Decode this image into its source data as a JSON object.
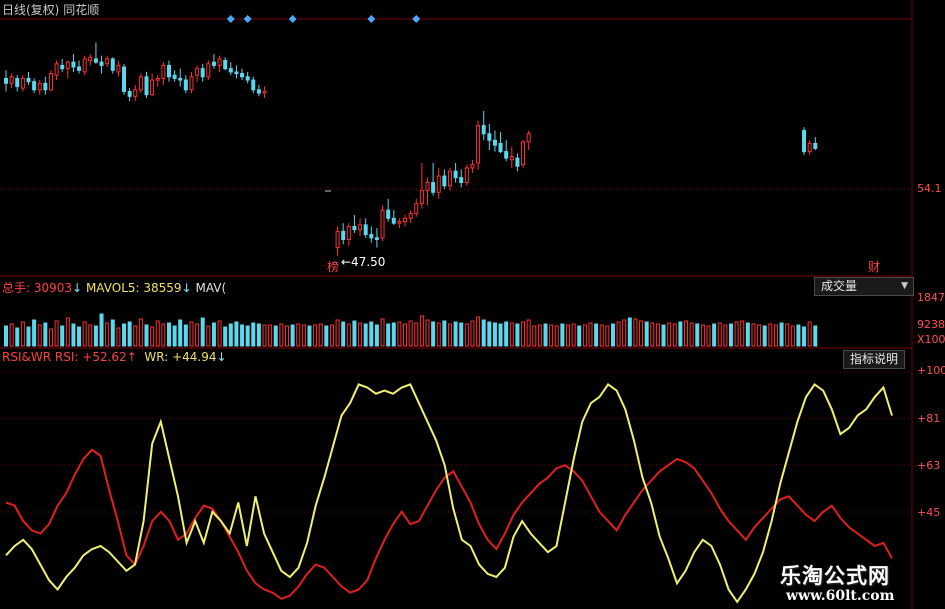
{
  "header": {
    "chart_title": "日线(复权)",
    "software": "同花顺",
    "last_price_label": "54.1",
    "low_marker": "←47.50",
    "low_tag": "榜",
    "right_tag": "财"
  },
  "volume_header": {
    "name": "总手:",
    "value": "30903",
    "value_arrow": "↓",
    "mavol5_label": "MAVOL5:",
    "mavol5_value": "38559",
    "mavol5_arrow": "↓",
    "mavol10_label": "MAV("
  },
  "volume_button": {
    "label": "成交量",
    "arrow": "▼"
  },
  "volume_axis": {
    "top": "1847",
    "mid": "9238",
    "unit": "X100"
  },
  "rsi_header": {
    "name": "RSI&WR",
    "rsi_label": "RSI:",
    "rsi_value": "+52.62",
    "rsi_arrow": "↑",
    "wr_label": "WR:",
    "wr_value": "+44.94",
    "wr_arrow": "↓"
  },
  "indicator_button": {
    "label": "指标说明"
  },
  "rsi_axis": [
    "+100",
    "+81",
    "+63",
    "+45"
  ],
  "watermark": {
    "cn": "乐淘公式网",
    "url": "www.60lt.com"
  },
  "colors": {
    "up": "#ff3030",
    "down": "#5ad8ee",
    "rsi": "#e02020",
    "wr": "#f0f070",
    "grid": "#7a0000",
    "diamond": "#4aa8ff"
  },
  "chart_data": [
    {
      "type": "candlestick",
      "ylim": [
        46.5,
        61.5
      ],
      "candles": [
        [
          58.4,
          58.9,
          57.6,
          58.1
        ],
        [
          58.1,
          58.7,
          57.8,
          58.5
        ],
        [
          58.4,
          58.6,
          57.6,
          57.9
        ],
        [
          57.8,
          58.6,
          57.6,
          58.4
        ],
        [
          58.4,
          58.8,
          58.0,
          58.2
        ],
        [
          58.2,
          58.4,
          57.5,
          57.7
        ],
        [
          57.7,
          58.3,
          57.4,
          58.1
        ],
        [
          58.1,
          58.5,
          57.4,
          57.7
        ],
        [
          57.7,
          58.9,
          57.6,
          58.7
        ],
        [
          58.6,
          59.5,
          58.3,
          59.3
        ],
        [
          59.2,
          59.6,
          58.8,
          59.0
        ],
        [
          59.0,
          59.5,
          58.4,
          59.4
        ],
        [
          59.4,
          59.9,
          58.8,
          59.1
        ],
        [
          59.1,
          59.5,
          58.7,
          58.9
        ],
        [
          58.8,
          59.8,
          58.6,
          59.6
        ],
        [
          59.5,
          59.9,
          59.2,
          59.7
        ],
        [
          59.6,
          60.6,
          59.3,
          59.4
        ],
        [
          59.4,
          59.8,
          58.7,
          59.2
        ],
        [
          59.3,
          59.8,
          59.1,
          59.6
        ],
        [
          59.6,
          59.7,
          58.7,
          58.9
        ],
        [
          58.8,
          59.5,
          58.5,
          59.2
        ],
        [
          59.1,
          59.3,
          57.4,
          57.6
        ],
        [
          57.6,
          57.8,
          57.0,
          57.3
        ],
        [
          57.3,
          58.0,
          57.0,
          57.7
        ],
        [
          57.7,
          58.7,
          57.5,
          58.5
        ],
        [
          58.5,
          58.8,
          57.2,
          57.4
        ],
        [
          57.4,
          58.7,
          57.3,
          58.3
        ],
        [
          58.3,
          58.6,
          57.9,
          58.4
        ],
        [
          58.4,
          59.4,
          58.0,
          59.2
        ],
        [
          59.2,
          59.5,
          58.2,
          58.5
        ],
        [
          58.6,
          58.9,
          58.2,
          58.4
        ],
        [
          58.4,
          59.0,
          57.9,
          58.3
        ],
        [
          58.3,
          58.6,
          57.5,
          57.7
        ],
        [
          57.7,
          58.8,
          57.5,
          58.5
        ],
        [
          58.6,
          59.2,
          58.2,
          59.0
        ],
        [
          59.0,
          59.3,
          58.2,
          58.5
        ],
        [
          58.5,
          59.5,
          58.3,
          59.3
        ],
        [
          59.4,
          59.9,
          59.0,
          59.2
        ],
        [
          59.2,
          59.8,
          58.8,
          59.6
        ],
        [
          59.5,
          59.7,
          58.9,
          59.0
        ],
        [
          59.0,
          59.4,
          58.6,
          58.8
        ],
        [
          58.8,
          59.2,
          58.4,
          58.7
        ],
        [
          58.7,
          59.0,
          58.3,
          58.5
        ],
        [
          58.5,
          58.8,
          58.1,
          58.3
        ],
        [
          58.3,
          58.5,
          57.5,
          57.7
        ],
        [
          57.7,
          58.0,
          57.3,
          57.5
        ],
        [
          57.5,
          57.9,
          57.2,
          57.6
        ],
        [
          null,
          null,
          null,
          null
        ],
        [
          null,
          null,
          null,
          null
        ],
        [
          null,
          null,
          null,
          null
        ],
        [
          null,
          null,
          null,
          null
        ],
        [
          null,
          null,
          null,
          null
        ],
        [
          null,
          null,
          null,
          null
        ],
        [
          null,
          null,
          null,
          null
        ],
        [
          null,
          null,
          null,
          null
        ],
        [
          null,
          null,
          null,
          null
        ],
        [
          null,
          null,
          null,
          null
        ],
        [
          null,
          null,
          null,
          null
        ],
        [
          null,
          null,
          null,
          null
        ],
        [
          48.0,
          49.3,
          47.5,
          49.0
        ],
        [
          49.0,
          49.5,
          48.2,
          48.5
        ],
        [
          48.5,
          49.5,
          48.1,
          49.3
        ],
        [
          49.3,
          50.0,
          48.9,
          49.1
        ],
        [
          49.1,
          49.8,
          48.7,
          49.4
        ],
        [
          49.4,
          49.8,
          48.6,
          48.8
        ],
        [
          48.8,
          49.3,
          48.3,
          48.6
        ],
        [
          48.6,
          49.2,
          48.0,
          48.5
        ],
        [
          48.6,
          50.6,
          48.4,
          50.3
        ],
        [
          50.3,
          51.0,
          49.6,
          49.8
        ],
        [
          49.8,
          50.3,
          49.4,
          49.5
        ],
        [
          49.5,
          49.8,
          49.2,
          49.6
        ],
        [
          49.6,
          50.0,
          49.3,
          49.8
        ],
        [
          49.8,
          50.3,
          49.5,
          50.1
        ],
        [
          50.1,
          51.0,
          49.9,
          50.7
        ],
        [
          50.7,
          53.2,
          50.4,
          51.5
        ],
        [
          51.5,
          52.3,
          50.6,
          52.0
        ],
        [
          52.0,
          53.2,
          51.2,
          51.4
        ],
        [
          51.4,
          52.9,
          51.0,
          52.4
        ],
        [
          52.4,
          52.8,
          51.6,
          51.8
        ],
        [
          51.8,
          52.9,
          51.5,
          52.7
        ],
        [
          52.7,
          53.2,
          52.0,
          52.3
        ],
        [
          52.3,
          52.8,
          51.7,
          52.0
        ],
        [
          52.0,
          53.1,
          51.8,
          52.9
        ],
        [
          52.9,
          53.4,
          52.6,
          53.1
        ],
        [
          53.2,
          55.8,
          52.8,
          55.5
        ],
        [
          55.5,
          56.4,
          54.6,
          55.0
        ],
        [
          55.0,
          55.6,
          54.0,
          54.6
        ],
        [
          54.6,
          55.2,
          53.9,
          54.3
        ],
        [
          54.4,
          55.1,
          53.8,
          53.9
        ],
        [
          53.9,
          54.6,
          53.3,
          53.5
        ],
        [
          53.4,
          54.2,
          52.9,
          53.6
        ],
        [
          53.5,
          53.8,
          52.7,
          53.0
        ],
        [
          53.1,
          54.6,
          52.9,
          54.5
        ],
        [
          54.5,
          55.2,
          54.0,
          55.0
        ],
        [
          null,
          null,
          null,
          null
        ],
        [
          null,
          null,
          null,
          null
        ],
        [
          null,
          null,
          null,
          null
        ],
        [
          null,
          null,
          null,
          null
        ],
        [
          null,
          null,
          null,
          null
        ],
        [
          null,
          null,
          null,
          null
        ],
        [
          null,
          null,
          null,
          null
        ],
        [
          null,
          null,
          null,
          null
        ],
        [
          null,
          null,
          null,
          null
        ],
        [
          null,
          null,
          null,
          null
        ],
        [
          null,
          null,
          null,
          null
        ],
        [
          null,
          null,
          null,
          null
        ],
        [
          null,
          null,
          null,
          null
        ],
        [
          null,
          null,
          null,
          null
        ],
        [
          null,
          null,
          null,
          null
        ],
        [
          null,
          null,
          null,
          null
        ],
        [
          null,
          null,
          null,
          null
        ],
        [
          null,
          null,
          null,
          null
        ],
        [
          null,
          null,
          null,
          null
        ],
        [
          null,
          null,
          null,
          null
        ],
        [
          null,
          null,
          null,
          null
        ],
        [
          null,
          null,
          null,
          null
        ],
        [
          null,
          null,
          null,
          null
        ],
        [
          null,
          null,
          null,
          null
        ],
        [
          null,
          null,
          null,
          null
        ],
        [
          null,
          null,
          null,
          null
        ],
        [
          null,
          null,
          null,
          null
        ],
        [
          null,
          null,
          null,
          null
        ],
        [
          null,
          null,
          null,
          null
        ],
        [
          null,
          null,
          null,
          null
        ],
        [
          null,
          null,
          null,
          null
        ],
        [
          null,
          null,
          null,
          null
        ],
        [
          null,
          null,
          null,
          null
        ],
        [
          null,
          null,
          null,
          null
        ],
        [
          null,
          null,
          null,
          null
        ],
        [
          null,
          null,
          null,
          null
        ],
        [
          null,
          null,
          null,
          null
        ],
        [
          null,
          null,
          null,
          null
        ],
        [
          null,
          null,
          null,
          null
        ],
        [
          null,
          null,
          null,
          null
        ],
        [
          null,
          null,
          null,
          null
        ],
        [
          null,
          null,
          null,
          null
        ],
        [
          null,
          null,
          null,
          null
        ],
        [
          null,
          null,
          null,
          null
        ],
        [
          null,
          null,
          null,
          null
        ],
        [
          null,
          null,
          null,
          null
        ],
        [
          null,
          null,
          null,
          null
        ],
        [
          null,
          null,
          null,
          null
        ],
        [
          55.2,
          55.4,
          53.7,
          53.9
        ],
        [
          53.9,
          54.6,
          53.7,
          54.4
        ],
        [
          54.4,
          54.8,
          54.0,
          54.1
        ]
      ],
      "signal_bars": [
        40,
        43,
        51,
        65,
        73
      ]
    },
    {
      "type": "bar",
      "series": [
        {
          "name": "总手",
          "values": [
            20,
            22,
            18,
            24,
            19,
            26,
            21,
            23,
            17,
            25,
            20,
            28,
            22,
            19,
            24,
            21,
            20,
            32,
            23,
            26,
            18,
            22,
            24,
            20,
            27,
            21,
            19,
            25,
            22,
            23,
            20,
            26,
            21,
            24,
            22,
            28,
            20,
            23,
            25,
            19,
            22,
            24,
            21,
            20,
            23,
            22,
            21,
            21,
            20,
            22,
            20,
            21,
            22,
            21,
            20,
            21,
            22,
            20,
            21,
            26,
            24,
            22,
            25,
            23,
            22,
            24,
            21,
            27,
            22,
            23,
            24,
            22,
            25,
            23,
            30,
            26,
            24,
            23,
            25,
            22,
            24,
            23,
            22,
            25,
            29,
            26,
            24,
            23,
            22,
            24,
            23,
            22,
            24,
            26,
            20,
            21,
            22,
            21,
            20,
            22,
            21,
            22,
            20,
            21,
            23,
            22,
            21,
            20,
            22,
            24,
            26,
            28,
            27,
            25,
            24,
            23,
            22,
            21,
            23,
            22,
            24,
            25,
            23,
            22,
            21,
            20,
            22,
            23,
            21,
            22,
            24,
            25,
            23,
            22,
            21,
            20,
            22,
            21,
            23,
            22,
            20,
            21,
            19,
            24,
            20
          ]
        }
      ]
    },
    {
      "type": "line",
      "ylim": [
        25,
        100
      ],
      "series": [
        {
          "name": "RSI",
          "values": [
            58,
            57,
            52,
            49,
            48,
            51,
            57,
            61,
            67,
            72,
            75,
            73,
            62,
            52,
            41,
            38,
            44,
            52,
            55,
            52,
            46,
            48,
            53,
            57,
            56,
            52,
            47,
            42,
            36,
            32,
            30,
            29,
            27,
            28,
            31,
            35,
            38,
            37,
            34,
            31,
            29,
            30,
            33,
            40,
            46,
            51,
            55,
            51,
            52,
            57,
            62,
            66,
            68,
            63,
            58,
            51,
            46,
            43,
            48,
            54,
            58,
            61,
            64,
            66,
            69,
            70,
            68,
            65,
            60,
            55,
            52,
            49,
            54,
            58,
            62,
            65,
            68,
            70,
            72,
            71,
            69,
            65,
            61,
            56,
            52,
            49,
            46,
            50,
            53,
            56,
            59,
            60,
            57,
            54,
            52,
            55,
            57,
            53,
            50,
            48,
            46,
            44,
            45,
            40
          ]
        },
        {
          "name": "WR",
          "values": [
            41,
            44,
            46,
            43,
            38,
            33,
            30,
            34,
            37,
            41,
            43,
            44,
            42,
            39,
            36,
            38,
            52,
            77,
            84,
            72,
            60,
            45,
            52,
            45,
            55,
            52,
            48,
            58,
            44,
            60,
            48,
            42,
            36,
            34,
            37,
            45,
            57,
            66,
            76,
            86,
            90,
            96,
            95,
            93,
            94,
            93,
            95,
            96,
            90,
            84,
            78,
            70,
            56,
            46,
            44,
            38,
            35,
            34,
            37,
            47,
            52,
            48,
            45,
            42,
            44,
            58,
            72,
            84,
            90,
            92,
            96,
            94,
            88,
            78,
            66,
            58,
            47,
            40,
            32,
            36,
            42,
            46,
            44,
            38,
            30,
            26,
            30,
            35,
            42,
            52,
            64,
            74,
            84,
            92,
            96,
            94,
            88,
            80,
            82,
            86,
            88,
            92,
            95,
            86
          ]
        }
      ]
    }
  ]
}
